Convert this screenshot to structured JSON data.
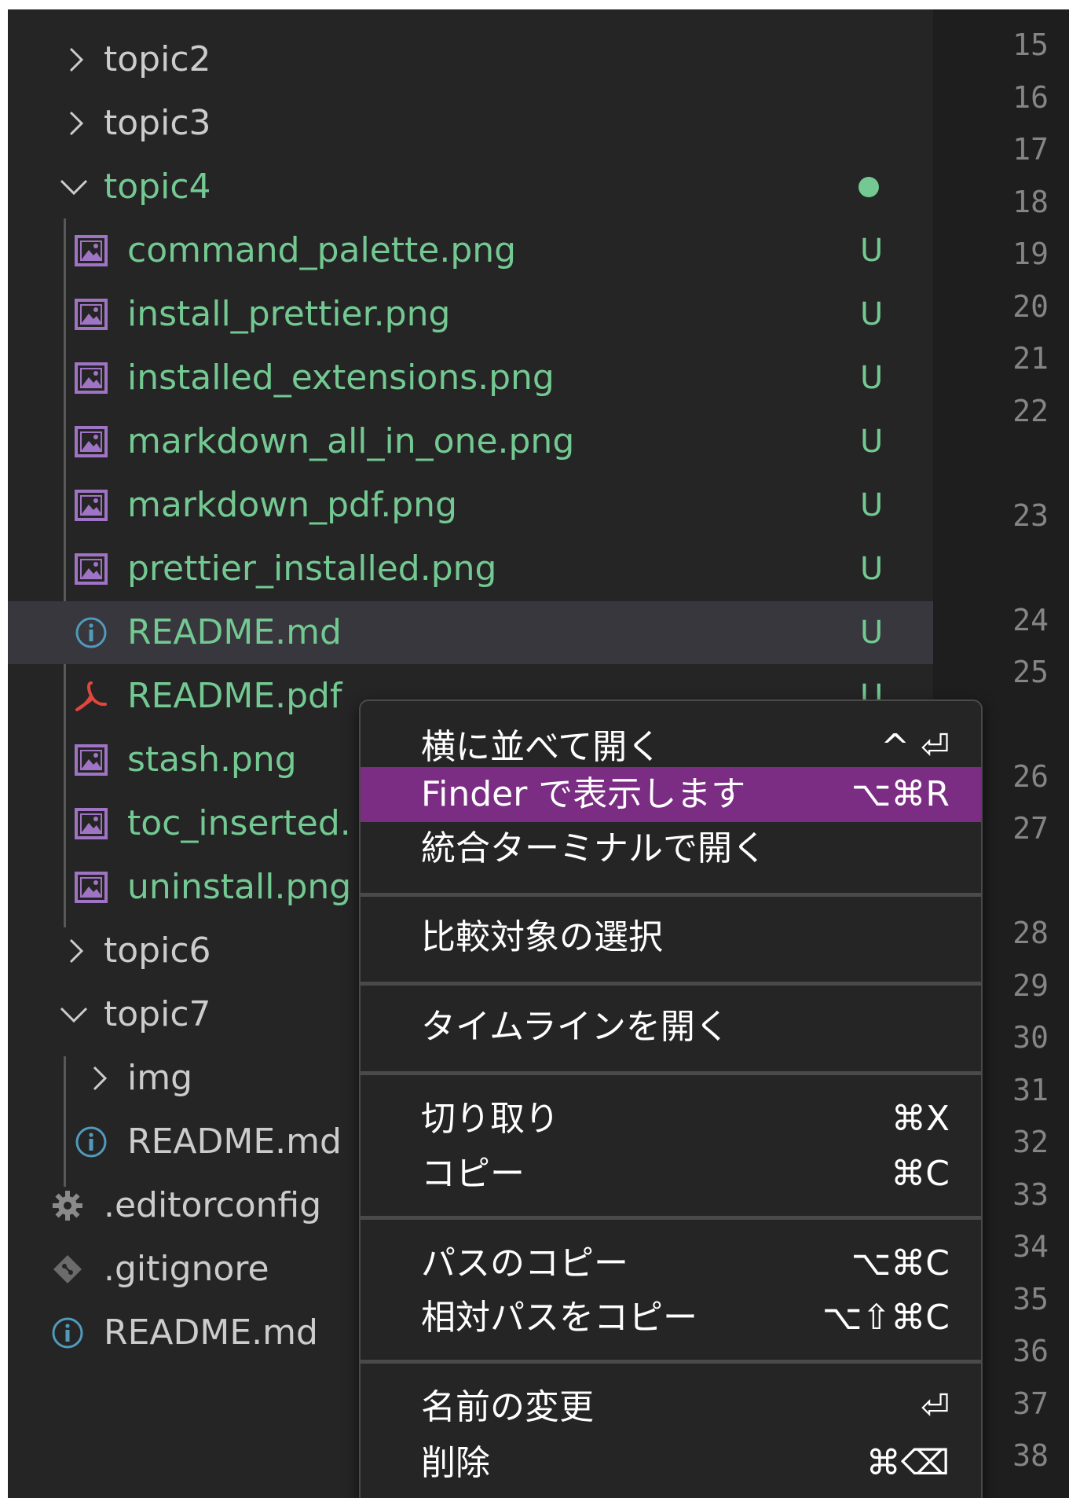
{
  "explorer": {
    "rows": [
      {
        "label": "topic2",
        "status": "",
        "modified": false
      },
      {
        "label": "topic3",
        "status": "",
        "modified": false
      },
      {
        "label": "topic4",
        "status": "",
        "modified": true
      },
      {
        "label": "command_palette.png",
        "status": "U"
      },
      {
        "label": "install_prettier.png",
        "status": "U"
      },
      {
        "label": "installed_extensions.png",
        "status": "U"
      },
      {
        "label": "markdown_all_in_one.png",
        "status": "U"
      },
      {
        "label": "markdown_pdf.png",
        "status": "U"
      },
      {
        "label": "prettier_installed.png",
        "status": "U"
      },
      {
        "label": "README.md",
        "status": "U",
        "selected": true
      },
      {
        "label": "README.pdf",
        "status": "U"
      },
      {
        "label": "stash.png",
        "status": ""
      },
      {
        "label": "toc_inserted.",
        "status": ""
      },
      {
        "label": "uninstall.png",
        "status": ""
      },
      {
        "label": "topic6",
        "status": ""
      },
      {
        "label": "topic7",
        "status": ""
      },
      {
        "label": "img",
        "status": ""
      },
      {
        "label": "README.md",
        "status": ""
      },
      {
        "label": ".editorconfig",
        "status": ""
      },
      {
        "label": ".gitignore",
        "status": ""
      },
      {
        "label": "README.md",
        "status": ""
      }
    ]
  },
  "gutter": {
    "line_numbers": [
      "15",
      "16",
      "17",
      "18",
      "19",
      "20",
      "21",
      "22",
      "23",
      "24",
      "25",
      "26",
      "27",
      "28",
      "29",
      "30",
      "31",
      "32",
      "33",
      "34",
      "35",
      "36",
      "37",
      "38"
    ]
  },
  "context_menu": {
    "items": [
      {
        "label": "横に並べて開く",
        "shortcut": "^ ⏎"
      },
      {
        "label": "Finder で表示します",
        "shortcut": "⌥⌘R",
        "highlighted": true
      },
      {
        "label": "統合ターミナルで開く",
        "shortcut": ""
      },
      {
        "label": "比較対象の選択",
        "shortcut": ""
      },
      {
        "label": "タイムラインを開く",
        "shortcut": ""
      },
      {
        "label": "切り取り",
        "shortcut": "⌘X"
      },
      {
        "label": "コピー",
        "shortcut": "⌘C"
      },
      {
        "label": "パスのコピー",
        "shortcut": "⌥⌘C"
      },
      {
        "label": "相対パスをコピー",
        "shortcut": "⌥⇧⌘C"
      },
      {
        "label": "名前の変更",
        "shortcut": "⏎"
      },
      {
        "label": "削除",
        "shortcut": "⌘⌫"
      }
    ]
  },
  "colors": {
    "sidebar_bg": "#252526",
    "editor_bg": "#1e1e1e",
    "untracked_green": "#73c991",
    "selection_bg": "#37373d",
    "menu_highlight": "#7b2d84",
    "image_icon": "#a074c4",
    "info_icon": "#519aba",
    "pdf_icon": "#e2463c"
  }
}
